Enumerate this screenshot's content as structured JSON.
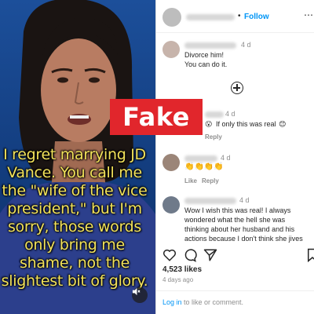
{
  "header": {
    "follow_label": "Follow",
    "separator": "•"
  },
  "media": {
    "caption": "I regret marrying JD Vance. You call me the \"wife of the vice president,\" but I'm sorry, those words only bring me shame, not the slightest bit of glory.",
    "mute_icon": "speaker-muted-icon"
  },
  "comments": [
    {
      "time": "4 d",
      "text_line1": "Divorce him!",
      "text_line2": "You can do it."
    },
    {
      "time": "4 d",
      "emoji_prefix": "😮",
      "text": "If only this was real",
      "emoji_suffix": "😊",
      "reply_label": "Reply"
    },
    {
      "time": "4 d",
      "text": "👏👏👏👏",
      "likes_label": "Like",
      "reply_label": "Reply"
    },
    {
      "time": "4 d",
      "text": "Wow I wish this was real! I always wondered what the hell she was thinking about her husband and his actions because I don't think she jives"
    }
  ],
  "post": {
    "likes": "4,523 likes",
    "ago": "4 days ago"
  },
  "login": {
    "link": "Log in",
    "rest": " to like or comment."
  },
  "stamp": {
    "label": "Fake",
    "color": "#e1262c"
  }
}
